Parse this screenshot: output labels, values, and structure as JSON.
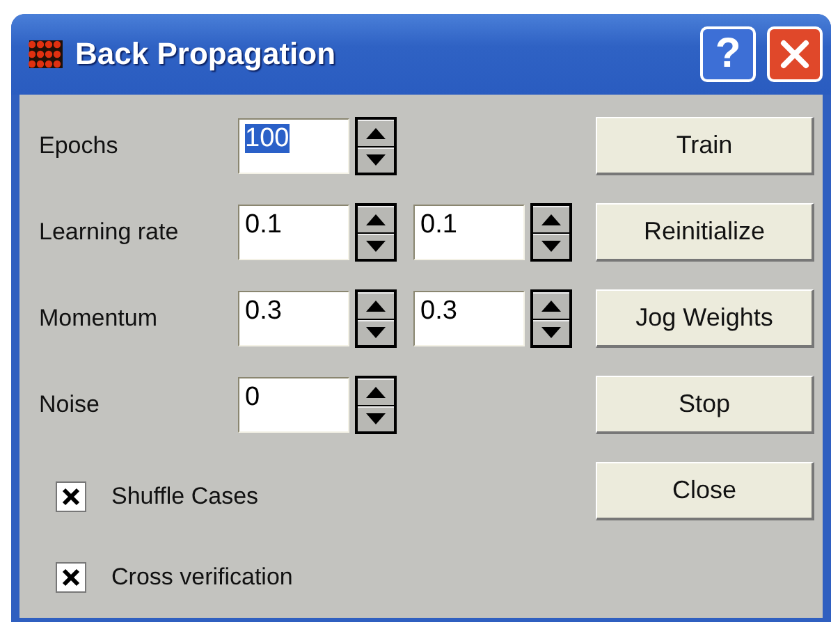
{
  "window": {
    "title": "Back Propagation",
    "help_button": "?"
  },
  "parameters": [
    {
      "label": "Epochs",
      "fields": [
        {
          "value": "100",
          "text_selected": true
        }
      ]
    },
    {
      "label": "Learning rate",
      "fields": [
        {
          "value": "0.1",
          "text_selected": false
        },
        {
          "value": "0.1",
          "text_selected": false
        }
      ]
    },
    {
      "label": "Momentum",
      "fields": [
        {
          "value": "0.3",
          "text_selected": false
        },
        {
          "value": "0.3",
          "text_selected": false
        }
      ]
    },
    {
      "label": "Noise",
      "fields": [
        {
          "value": "0",
          "text_selected": false
        }
      ]
    }
  ],
  "checkboxes": [
    {
      "label": "Shuffle Cases",
      "checked": true
    },
    {
      "label": "Cross verification",
      "checked": true
    }
  ],
  "buttons": [
    "Train",
    "Reinitialize",
    "Jog Weights",
    "Stop",
    "Close"
  ]
}
